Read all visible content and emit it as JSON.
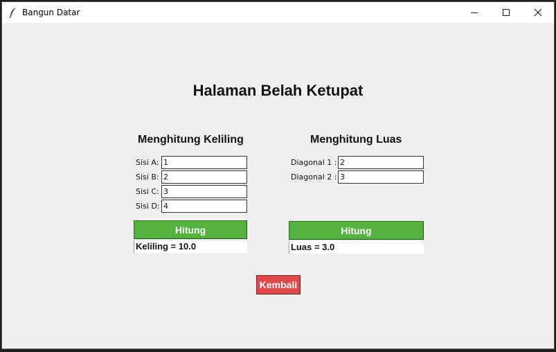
{
  "window": {
    "title": "Bangun Datar",
    "icon": "feather-icon",
    "controls": [
      "minimize-icon",
      "maximize-icon",
      "close-icon"
    ]
  },
  "page": {
    "title": "Halaman Belah Ketupat"
  },
  "keliling": {
    "title": "Menghitung Keliling",
    "fields": [
      {
        "label": "Sisi A:",
        "value": "1"
      },
      {
        "label": "Sisi B:",
        "value": "2"
      },
      {
        "label": "Sisi C:",
        "value": "3"
      },
      {
        "label": "Sisi D:",
        "value": "4"
      }
    ],
    "button_label": "Hitung",
    "result": "Keliling = 10.0"
  },
  "luas": {
    "title": "Menghitung Luas",
    "fields": [
      {
        "label": "Diagonal 1 :",
        "value": "2"
      },
      {
        "label": "Diagonal 2 :",
        "value": "3"
      }
    ],
    "button_label": "Hitung",
    "result": "Luas = 3.0"
  },
  "back_button_label": "Kembali",
  "colors": {
    "calc_button": "#54b33e",
    "back_button": "#e0484b",
    "background": "#f0f0f0"
  }
}
